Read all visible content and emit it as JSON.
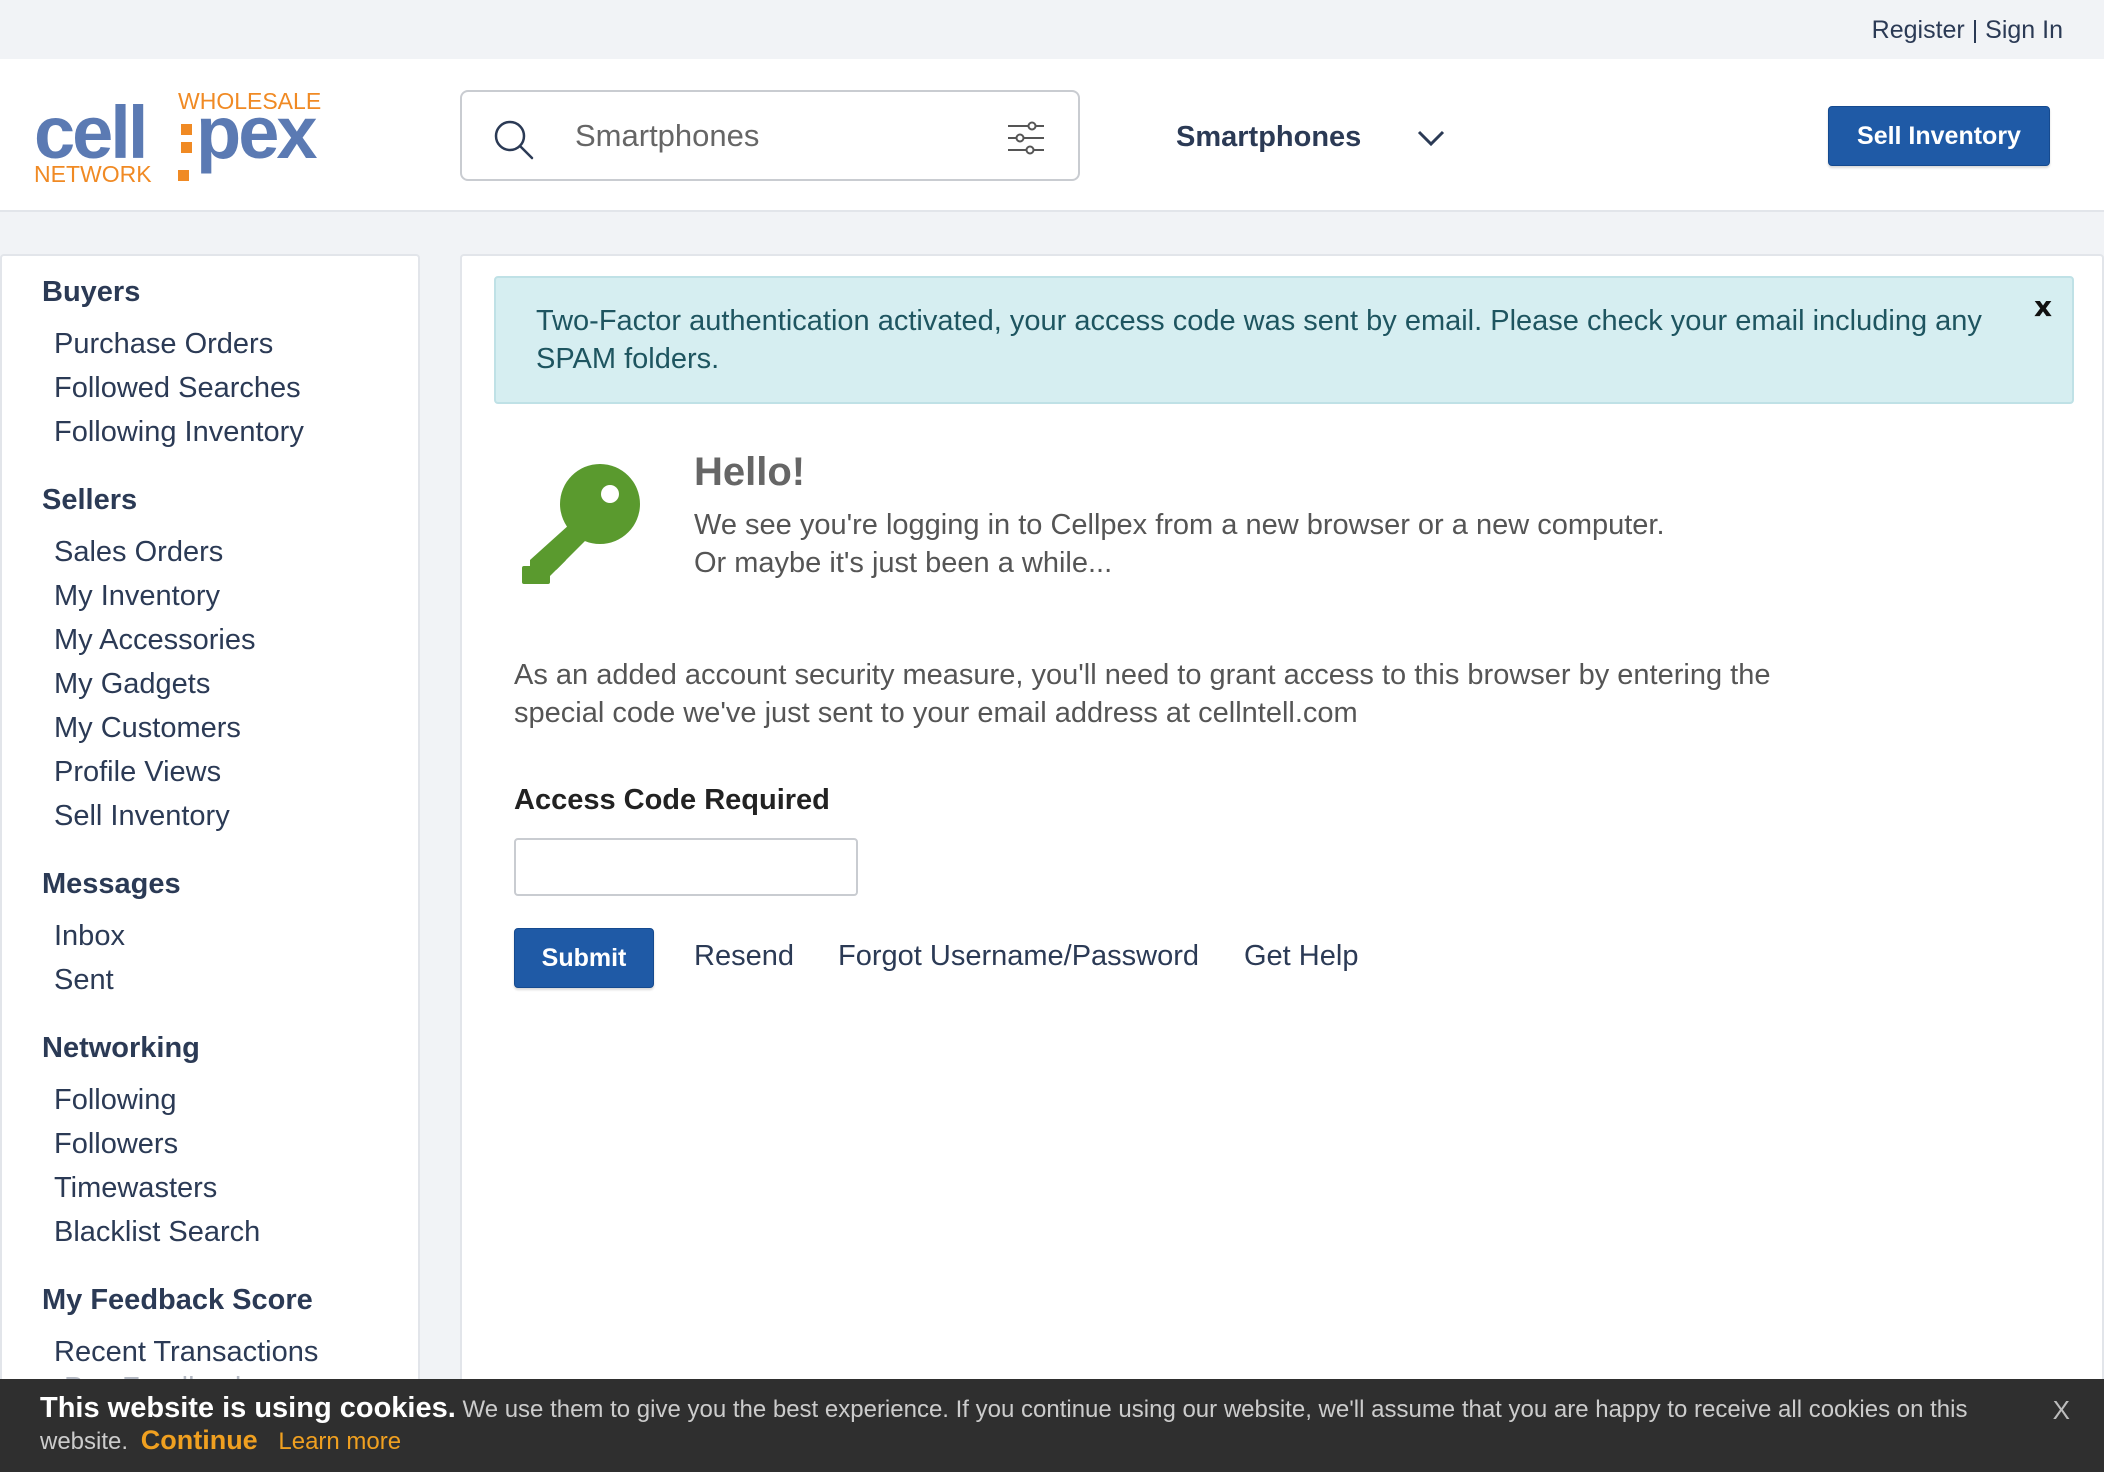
{
  "topbar": {
    "register": "Register",
    "separator": "|",
    "sign_in": "Sign In"
  },
  "header": {
    "logo": {
      "wholesale": "WHOLESALE",
      "cell": "cell",
      "pex": "pex",
      "network": "NETWORK"
    },
    "search": {
      "placeholder": "Smartphones"
    },
    "category": {
      "selected": "Smartphones"
    },
    "sell_button": "Sell Inventory"
  },
  "sidebar": {
    "buyers": {
      "title": "Buyers",
      "items": [
        "Purchase Orders",
        "Followed Searches",
        "Following Inventory"
      ]
    },
    "sellers": {
      "title": "Sellers",
      "items": [
        "Sales Orders",
        "My Inventory",
        "My Accessories",
        "My Gadgets",
        "My Customers",
        "Profile Views",
        "Sell Inventory"
      ]
    },
    "messages": {
      "title": "Messages",
      "items": [
        "Inbox",
        "Sent"
      ]
    },
    "networking": {
      "title": "Networking",
      "items": [
        "Following",
        "Followers",
        "Timewasters",
        "Blacklist Search"
      ]
    },
    "feedback": {
      "title": "My Feedback Score",
      "items": [
        "Recent Transactions",
        "Pay Feedback"
      ]
    }
  },
  "main": {
    "alert": {
      "text": "Two-Factor authentication activated, your access code was sent by email. Please check your email including any SPAM folders.",
      "close": "x"
    },
    "hello": "Hello!",
    "intro_line1": "We see you're logging in to Cellpex from a new browser or a new computer.",
    "intro_line2": "Or maybe it's just been a while...",
    "measure": "As an added account security measure, you'll need to grant access to this browser by entering the special code we've just sent to your email address at cellntell.com",
    "code_label": "Access Code Required",
    "code_value": "",
    "submit": "Submit",
    "links": {
      "resend": "Resend",
      "forgot": "Forgot Username/Password",
      "help": "Get Help"
    }
  },
  "cookie": {
    "title": "This website is using cookies.",
    "text": "We use them to give you the best experience. If you continue using our website, we'll assume that you are happy to receive all cookies on this website.",
    "continue": "Continue",
    "learn_more": "Learn more",
    "close": "X"
  },
  "colors": {
    "brand_blue": "#1f5aa6",
    "navy_text": "#2b3a55",
    "logo_orange": "#f08a24",
    "logo_blue": "#5b7ab3",
    "key_green": "#5a9a2e",
    "alert_bg": "#d6eef1"
  },
  "icons": {
    "search": "search-icon",
    "filter": "filter-icon",
    "chevron": "chevron-down-icon",
    "key": "key-icon"
  }
}
